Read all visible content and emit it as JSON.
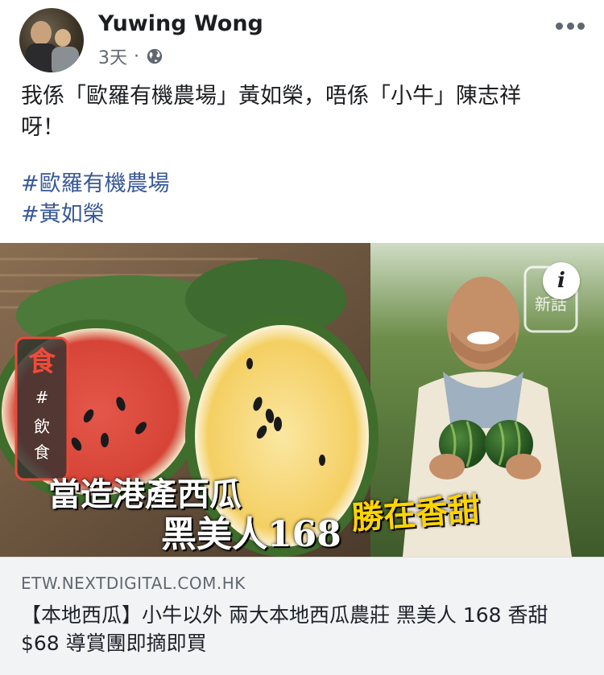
{
  "post": {
    "author": "Yuwing Wong",
    "time": "3天",
    "separator": "·",
    "text_line1": "我係「歐羅有機農場」黃如榮，唔係「小牛」陳志祥",
    "text_line2": "呀！",
    "hashtags": [
      "#歐羅有機農場",
      "#黃如榮"
    ]
  },
  "link_preview": {
    "image_labels": {
      "badge_char": "食",
      "badge_sub1": "#",
      "badge_sub2": "飲",
      "badge_sub3": "食",
      "caption_line1": "當造港產西瓜",
      "caption_line2": "黑美人168",
      "caption_highlight": "勝在香甜",
      "corner_logo": "新話",
      "info": "i"
    },
    "domain": "ETW.NEXTDIGITAL.COM.HK",
    "title": "【本地西瓜】小牛以外 兩大本地西瓜農莊 黑美人 168 香甜 $68 導賞團即摘即買"
  },
  "icons": {
    "more": "more-options-icon",
    "privacy": "globe-icon",
    "info": "info-icon"
  },
  "colors": {
    "hashtag": "#385898",
    "meta": "#606770",
    "preview_bg": "#f2f3f5",
    "caption_highlight": "#ffd400"
  }
}
